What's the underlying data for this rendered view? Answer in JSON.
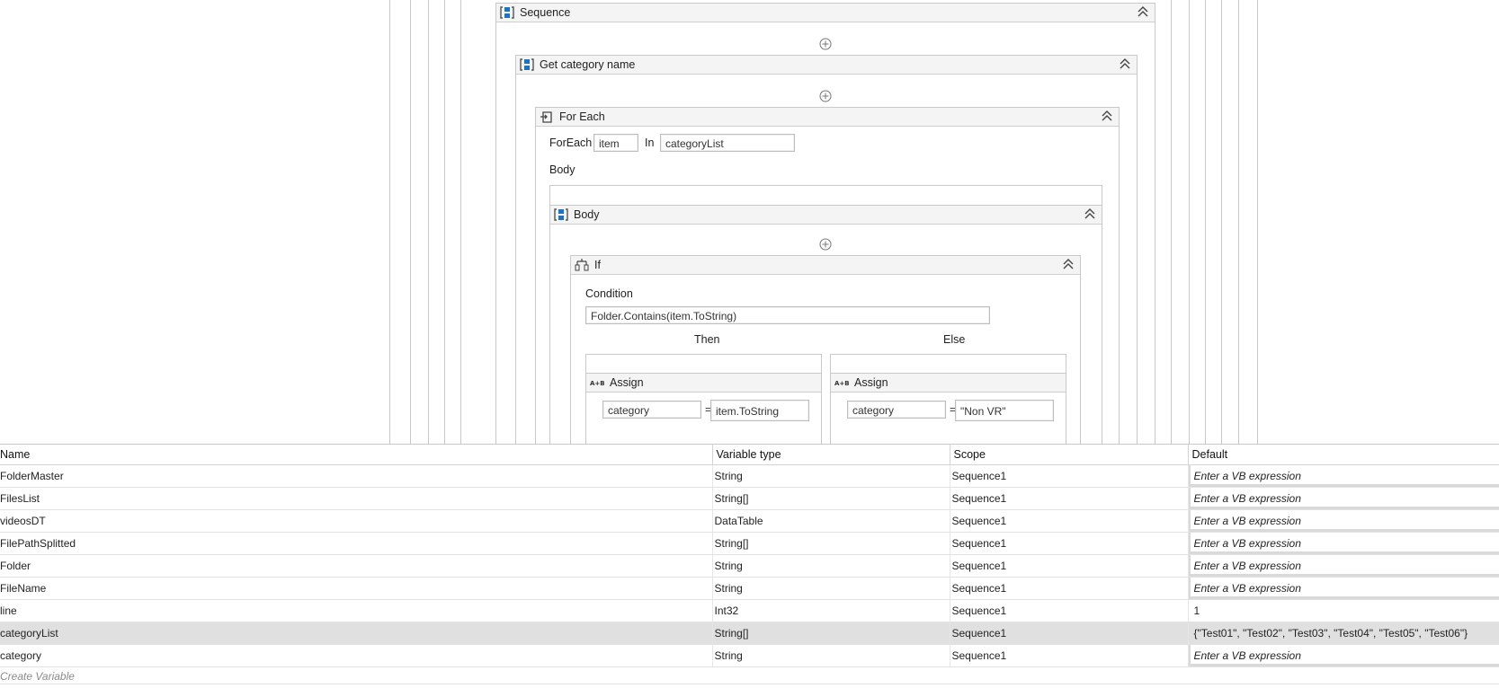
{
  "designer": {
    "sequence": {
      "title": "Sequence"
    },
    "get_category": {
      "title": "Get category name"
    },
    "foreach": {
      "title": "For Each",
      "foreach_label": "ForEach",
      "item_value": "item",
      "in_label": "In",
      "collection_value": "categoryList",
      "body_label": "Body"
    },
    "body": {
      "title": "Body"
    },
    "if": {
      "title": "If",
      "condition_label": "Condition",
      "condition_value": "Folder.Contains(item.ToString)",
      "then_label": "Then",
      "else_label": "Else",
      "then_assign": {
        "title": "Assign",
        "to": "category",
        "value": "item.ToString"
      },
      "else_assign": {
        "title": "Assign",
        "to": "category",
        "value": "\"Non VR\""
      }
    }
  },
  "variables": {
    "columns": [
      "Name",
      "Variable type",
      "Scope",
      "Default"
    ],
    "placeholder": "Enter a VB expression",
    "rows": [
      {
        "name": "FolderMaster",
        "type": "String",
        "scope": "Sequence1",
        "default": ""
      },
      {
        "name": "FilesList",
        "type": "String[]",
        "scope": "Sequence1",
        "default": ""
      },
      {
        "name": "videosDT",
        "type": "DataTable",
        "scope": "Sequence1",
        "default": ""
      },
      {
        "name": "FilePathSplitted",
        "type": "String[]",
        "scope": "Sequence1",
        "default": ""
      },
      {
        "name": "Folder",
        "type": "String",
        "scope": "Sequence1",
        "default": ""
      },
      {
        "name": "FileName",
        "type": "String",
        "scope": "Sequence1",
        "default": ""
      },
      {
        "name": "line",
        "type": "Int32",
        "scope": "Sequence1",
        "default": "1"
      },
      {
        "name": "categoryList",
        "type": "String[]",
        "scope": "Sequence1",
        "default": "{\"Test01\", \"Test02\", \"Test03\", \"Test04\", \"Test05\", \"Test06\"}"
      },
      {
        "name": "category",
        "type": "String",
        "scope": "Sequence1",
        "default": ""
      }
    ],
    "selected_row": 7,
    "create_label": "Create Variable"
  },
  "colors": {
    "accent_blue": "#1a73c8",
    "header_bg": "#f4f4f4",
    "selected_row": "#e0e0e0"
  },
  "icons": [
    "sequence-icon",
    "foreach-icon",
    "if-icon",
    "assign-icon",
    "collapse-icon",
    "add-activity-icon"
  ]
}
